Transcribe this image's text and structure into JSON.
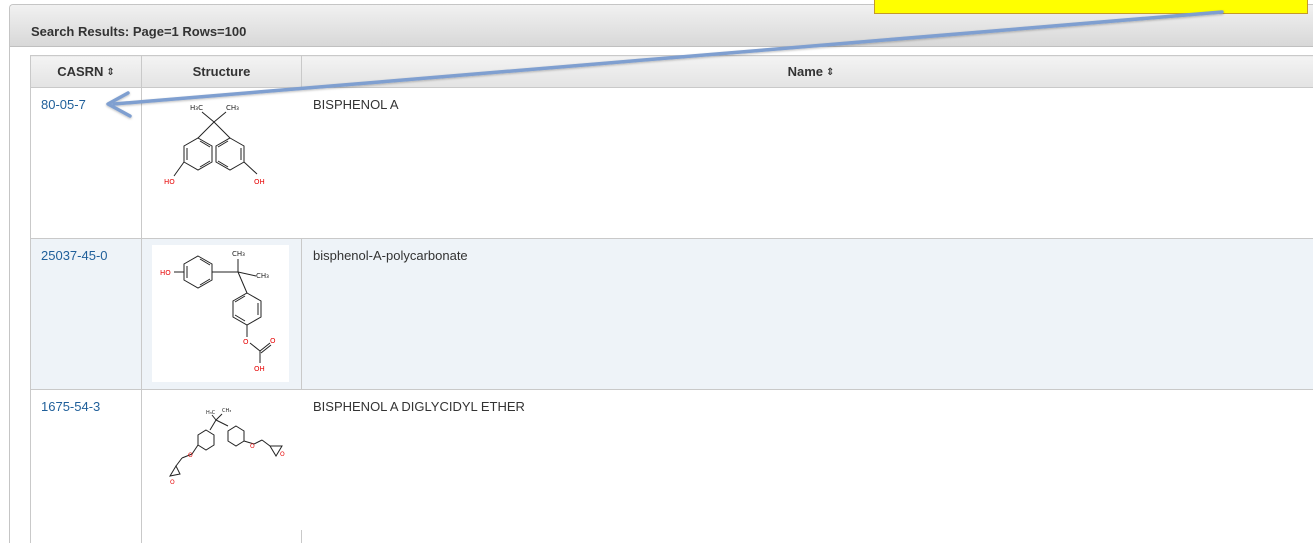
{
  "panel": {
    "title": "Search Results: Page=1 Rows=100"
  },
  "table": {
    "columns": [
      {
        "label": "CASRN",
        "sortable": true,
        "sort_icon": "sort-toggle-icon"
      },
      {
        "label": "Structure",
        "sortable": false
      },
      {
        "label": "Name",
        "sortable": true,
        "sort_icon": "sort-toggle-icon"
      }
    ],
    "rows": [
      {
        "casrn": "80-05-7",
        "name": "BISPHENOL A",
        "structure_labels": {
          "h3c": "H₃C",
          "ch3": "CH₃",
          "ho": "HO",
          "oh": "OH"
        }
      },
      {
        "casrn": "25037-45-0",
        "name": "bisphenol-A-polycarbonate",
        "structure_labels": {
          "ch3_top": "CH₃",
          "ch3_right": "CH₃",
          "ho": "HO",
          "o_link": "O",
          "o_carbonyl": "O",
          "oh": "OH"
        }
      },
      {
        "casrn": "1675-54-3",
        "name": "BISPHENOL A DIGLYCIDYL ETHER",
        "structure_labels": {
          "h3c": "H₃C",
          "ch3": "CH₃",
          "o1": "O",
          "o2": "O",
          "o3": "O",
          "o4": "O"
        }
      }
    ]
  },
  "annotation": {
    "callout_color": "#ffff00",
    "arrow_color": "#7f9fd0"
  },
  "colors": {
    "link": "#1f5f9a",
    "row_alt": "#eef3f8",
    "heteroatom": "#e60000"
  }
}
